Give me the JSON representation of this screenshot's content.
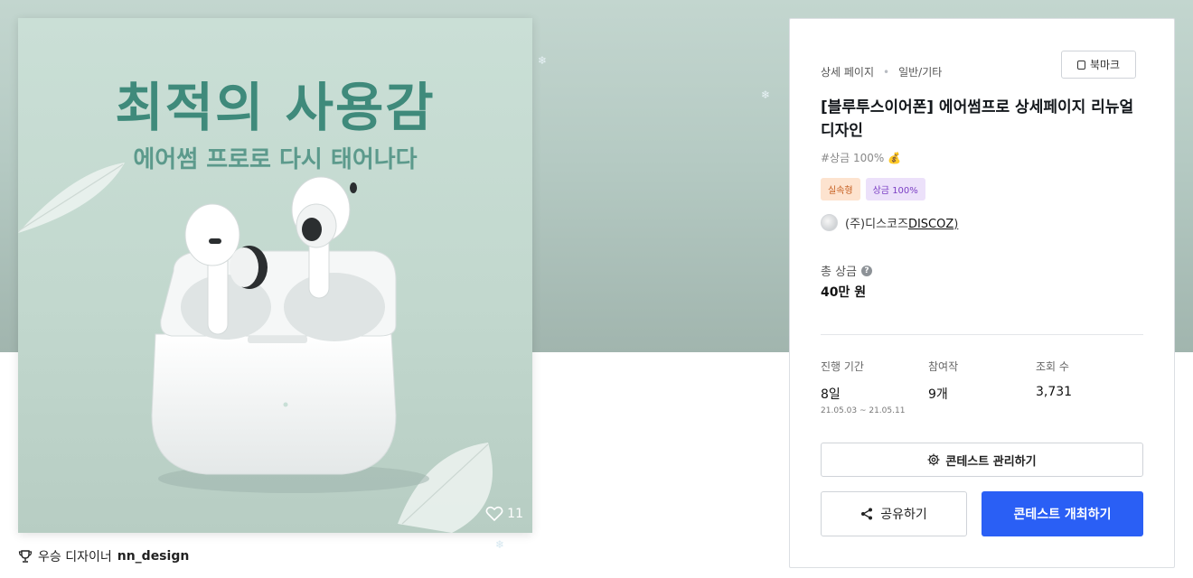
{
  "image": {
    "headline": "최적의 사용감",
    "subheadline": "에어썸 프로로 다시 태어나다",
    "likes": "11",
    "like_icon": "heart-icon"
  },
  "caption": {
    "prefix": "우승 디자이너",
    "designer": "nn_design",
    "icon": "trophy-icon"
  },
  "panel": {
    "breadcrumb": [
      "상세 페이지",
      "일반/기타"
    ],
    "bookmark_label": "북마크",
    "title": "[블루투스이어폰] 에어썸프로 상세페이지 리뉴얼 디자인",
    "prize_tag": "#상금 100%",
    "badges": [
      "실속형",
      "상금 100%"
    ],
    "host_name": "(주)디스코즈",
    "host_link": "DISCOZ",
    "total_prize_label": "총 상금",
    "total_prize_value": "40만 원",
    "stats": {
      "period_label": "진행 기간",
      "period_value": "8일",
      "period_range": "21.05.03 ~ 21.05.11",
      "entries_label": "참여작",
      "entries_value": "9개",
      "views_label": "조회 수",
      "views_value": "3,731"
    },
    "manage_label": "콘테스트 관리하기",
    "share_label": "공유하기",
    "host_contest_label": "콘테스트 개최하기"
  },
  "colors": {
    "primary": "#2a5ff5",
    "hero_bg": "#b5cac3",
    "image_bg": "#c2d8ce",
    "headline": "#3f8a7b"
  }
}
